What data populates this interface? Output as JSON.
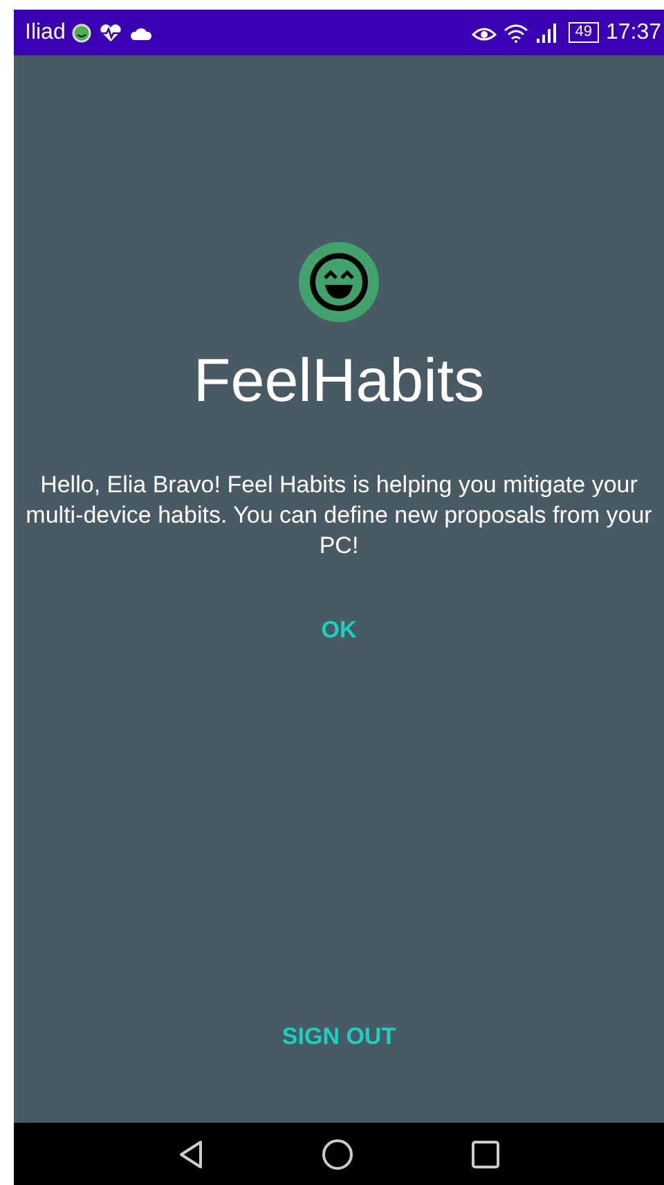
{
  "status_bar": {
    "carrier": "Iliad",
    "battery": "49",
    "time": "17:37"
  },
  "app": {
    "title": "FeelHabits",
    "message": "Hello, Elia Bravo! Feel Habits is helping you mitigate your multi-device habits. You can define new proposals from your PC!",
    "ok_button": "OK",
    "sign_out_button": "SIGN OUT"
  }
}
